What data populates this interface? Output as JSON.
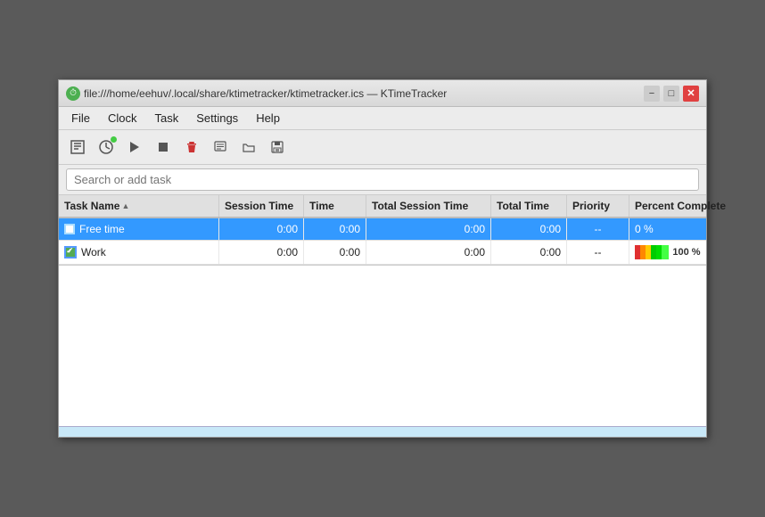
{
  "window": {
    "title": "file:///home/eehuv/.local/share/ktimetracker/ktimetracker.ics — KTimeTracker",
    "app_icon": "⏱"
  },
  "titlebar": {
    "minimize_label": "−",
    "maximize_label": "□",
    "close_label": "✕"
  },
  "menubar": {
    "items": [
      {
        "label": "File"
      },
      {
        "label": "Clock"
      },
      {
        "label": "Task"
      },
      {
        "label": "Settings"
      },
      {
        "label": "Help"
      }
    ]
  },
  "toolbar": {
    "buttons": [
      {
        "name": "new-task-button",
        "icon": "📄"
      },
      {
        "name": "start-timer-button",
        "icon": "▶",
        "active": true
      },
      {
        "name": "play-button",
        "icon": "▶"
      },
      {
        "name": "stop-button",
        "icon": "■"
      },
      {
        "name": "delete-button",
        "icon": "🗑"
      },
      {
        "name": "edit-button",
        "icon": "📝"
      },
      {
        "name": "open-button",
        "icon": "📁"
      },
      {
        "name": "save-button",
        "icon": "💾"
      }
    ]
  },
  "search": {
    "placeholder": "Search or add task"
  },
  "table": {
    "columns": [
      {
        "id": "task-name",
        "label": "Task Name",
        "sortable": true
      },
      {
        "id": "session-time",
        "label": "Session Time"
      },
      {
        "id": "time",
        "label": "Time"
      },
      {
        "id": "total-session-time",
        "label": "Total Session Time"
      },
      {
        "id": "total-time",
        "label": "Total Time"
      },
      {
        "id": "priority",
        "label": "Priority"
      },
      {
        "id": "percent-complete",
        "label": "Percent Complete"
      }
    ],
    "rows": [
      {
        "id": "row-free-time",
        "selected": true,
        "task_name": "Free time",
        "checkbox_checked": false,
        "session_time": "0:00",
        "time": "0:00",
        "total_session_time": "0:00",
        "total_time": "0:00",
        "priority": "--",
        "percent": "0 %",
        "percent_value": 0,
        "bar_segments": []
      },
      {
        "id": "row-work",
        "selected": false,
        "task_name": "Work",
        "checkbox_checked": true,
        "session_time": "0:00",
        "time": "0:00",
        "total_session_time": "0:00",
        "total_time": "0:00",
        "priority": "--",
        "percent": "100 %",
        "percent_value": 100,
        "bar_segments": [
          {
            "color": "#e03030",
            "width": "16%"
          },
          {
            "color": "#ff8800",
            "width": "16%"
          },
          {
            "color": "#ffcc00",
            "width": "16%"
          },
          {
            "color": "#00cc00",
            "width": "16%"
          },
          {
            "color": "#00ee00",
            "width": "16%"
          },
          {
            "color": "#44ff44",
            "width": "16%"
          }
        ]
      }
    ]
  }
}
